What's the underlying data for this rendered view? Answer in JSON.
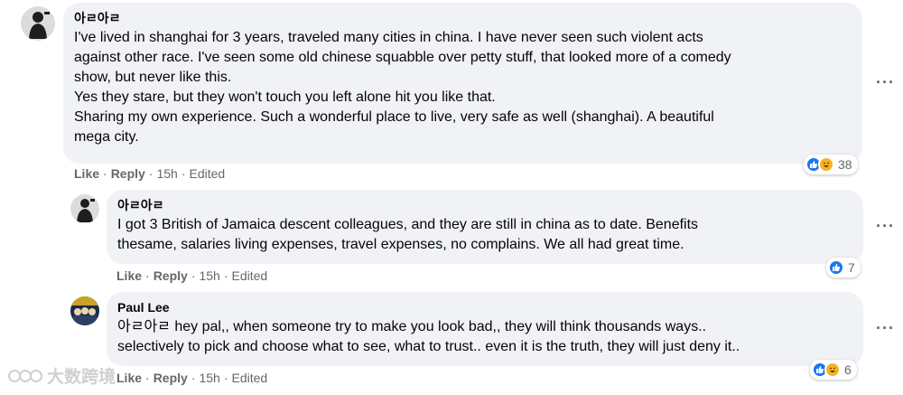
{
  "comments": [
    {
      "author": "아ㄹ아ㄹ",
      "lines": [
        "I've lived in shanghai for 3 years, traveled many cities in china. I have never seen such violent acts",
        "against other race. I've seen some old chinese squabble over petty stuff, that looked more of a comedy",
        "show, but never like this.",
        "Yes they stare, but they won't touch you left alone hit you like that.",
        "Sharing my own experience. Such a wonderful place to live, very safe as well (shanghai). A beautiful",
        "mega city."
      ],
      "actions": {
        "like": "Like",
        "reply": "Reply",
        "time": "15h",
        "edited": "Edited"
      },
      "reaction_count": "38",
      "reaction_icons": [
        "like-icon",
        "haha-icon"
      ]
    },
    {
      "author": "아ㄹ아ㄹ",
      "lines": [
        "I got 3 British of Jamaica descent colleagues, and they are still in china as to date. Benefits",
        "thesame, salaries living expenses, travel expenses, no complains. We all had great time."
      ],
      "actions": {
        "like": "Like",
        "reply": "Reply",
        "time": "15h",
        "edited": "Edited"
      },
      "reaction_count": "7",
      "reaction_icons": [
        "like-icon"
      ]
    },
    {
      "author": "Paul Lee",
      "lines": [
        "아ㄹ아ㄹ hey pal,, when someone try to make you look bad,, they will think thousands ways..",
        "selectively to pick and choose what to see, what to trust.. even it is the truth, they will just deny it.."
      ],
      "actions": {
        "like": "Like",
        "reply": "Reply",
        "time": "15h",
        "edited": "Edited"
      },
      "reaction_count": "6",
      "reaction_icons": [
        "like-icon",
        "haha-icon"
      ]
    }
  ],
  "more_label": "···",
  "watermark": "大数跨境",
  "colors": {
    "bubble": "#f0f2f5",
    "meta": "#65676b",
    "like": "#1877f2",
    "haha": "#f7b125"
  }
}
